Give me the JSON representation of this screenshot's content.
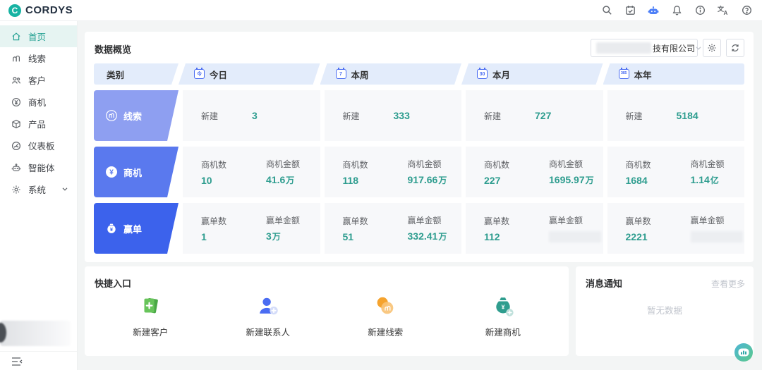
{
  "brand": {
    "logo_text": "CORDYS"
  },
  "topbar": {
    "icons": [
      {
        "name": "search"
      },
      {
        "name": "calendar-schedule"
      },
      {
        "name": "ai-robot"
      },
      {
        "name": "notification-bell"
      },
      {
        "name": "info"
      },
      {
        "name": "translate"
      },
      {
        "name": "help"
      }
    ]
  },
  "sidebar": {
    "items": [
      {
        "label": "首页",
        "icon": "home",
        "active": true
      },
      {
        "label": "线索",
        "icon": "leads"
      },
      {
        "label": "客户",
        "icon": "customers"
      },
      {
        "label": "商机",
        "icon": "opportunities"
      },
      {
        "label": "产品",
        "icon": "products"
      },
      {
        "label": "仪表板",
        "icon": "dashboard"
      },
      {
        "label": "智能体",
        "icon": "agent"
      },
      {
        "label": "系统",
        "icon": "system",
        "expandable": true
      }
    ]
  },
  "overview": {
    "title": "数据概览",
    "company_select": {
      "visible_text": "技有限公司",
      "redacted_prefix": true
    },
    "header": {
      "category": "类别",
      "periods": [
        {
          "label": "今日",
          "badge": "今"
        },
        {
          "label": "本周",
          "badge": "7"
        },
        {
          "label": "本月",
          "badge": "30"
        },
        {
          "label": "本年",
          "badge": "365"
        }
      ]
    },
    "accent_colors": {
      "row_lead": "#8e9ff1",
      "row_opportunity": "#5a79ee",
      "row_win": "#3c62ec",
      "value_teal": "#2e9d8f",
      "header_bg": "#e3ecfb",
      "period_icon_blue": "#4a6cf2",
      "brand_teal": "#17b3a3"
    },
    "rows": [
      {
        "label": "线索",
        "icon": "leads",
        "color": "#8e9ff1",
        "cells": [
          [
            {
              "k": "新建",
              "v": "3"
            }
          ],
          [
            {
              "k": "新建",
              "v": "333"
            }
          ],
          [
            {
              "k": "新建",
              "v": "727"
            }
          ],
          [
            {
              "k": "新建",
              "v": "5184"
            }
          ]
        ]
      },
      {
        "label": "商机",
        "icon": "yen-coin",
        "color": "#5a79ee",
        "cells": [
          [
            {
              "k": "商机数",
              "v": "10"
            },
            {
              "k": "商机金额",
              "v": "41.6",
              "u": "万"
            }
          ],
          [
            {
              "k": "商机数",
              "v": "118"
            },
            {
              "k": "商机金额",
              "v": "917.66",
              "u": "万"
            }
          ],
          [
            {
              "k": "商机数",
              "v": "227"
            },
            {
              "k": "商机金额",
              "v": "1695.97",
              "u": "万"
            }
          ],
          [
            {
              "k": "商机数",
              "v": "1684"
            },
            {
              "k": "商机金额",
              "v": "1.14",
              "u": "亿"
            }
          ]
        ]
      },
      {
        "label": "赢单",
        "icon": "money-bag",
        "color": "#3c62ec",
        "cells": [
          [
            {
              "k": "赢单数",
              "v": "1"
            },
            {
              "k": "赢单金额",
              "v": "3",
              "u": "万"
            }
          ],
          [
            {
              "k": "赢单数",
              "v": "51"
            },
            {
              "k": "赢单金额",
              "v": "332.41",
              "u": "万"
            }
          ],
          [
            {
              "k": "赢单数",
              "v": "112"
            },
            {
              "k": "赢单金额",
              "redacted": true
            }
          ],
          [
            {
              "k": "赢单数",
              "v": "2221"
            },
            {
              "k": "赢单金额",
              "redacted": true
            }
          ]
        ]
      }
    ]
  },
  "quick_entry": {
    "title": "快捷入口",
    "items": [
      {
        "label": "新建客户",
        "icon": "new-customer"
      },
      {
        "label": "新建联系人",
        "icon": "new-contact"
      },
      {
        "label": "新建线索",
        "icon": "new-lead"
      },
      {
        "label": "新建商机",
        "icon": "new-opportunity"
      }
    ]
  },
  "notifications": {
    "title": "消息通知",
    "more_label": "查看更多",
    "empty_text": "暂无数据"
  }
}
